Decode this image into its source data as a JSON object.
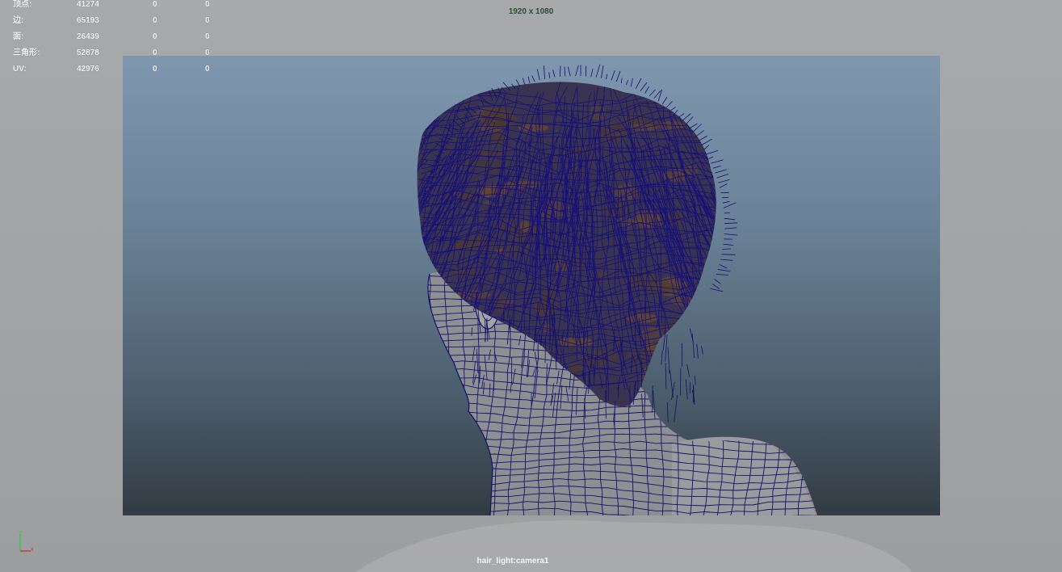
{
  "viewport": {
    "resolution": "1920 x 1080",
    "camera": "hair_light:camera1",
    "background_colors": [
      "#7e97af",
      "#323b43"
    ],
    "wireframe_color": "#14106b"
  },
  "stats": [
    {
      "label": "顶点:",
      "value": "41274",
      "a": "0",
      "b": "0"
    },
    {
      "label": "边:",
      "value": "65193",
      "a": "0",
      "b": "0"
    },
    {
      "label": "面:",
      "value": "26439",
      "a": "0",
      "b": "0"
    },
    {
      "label": "三角形:",
      "value": "52878",
      "a": "0",
      "b": "0"
    },
    {
      "label": "UV:",
      "value": "42976",
      "a": "0",
      "b": "0"
    }
  ],
  "axis": {
    "icon": "axis-gizmo-icon",
    "y_color": "#3ec43e",
    "x_color": "#d23030"
  }
}
